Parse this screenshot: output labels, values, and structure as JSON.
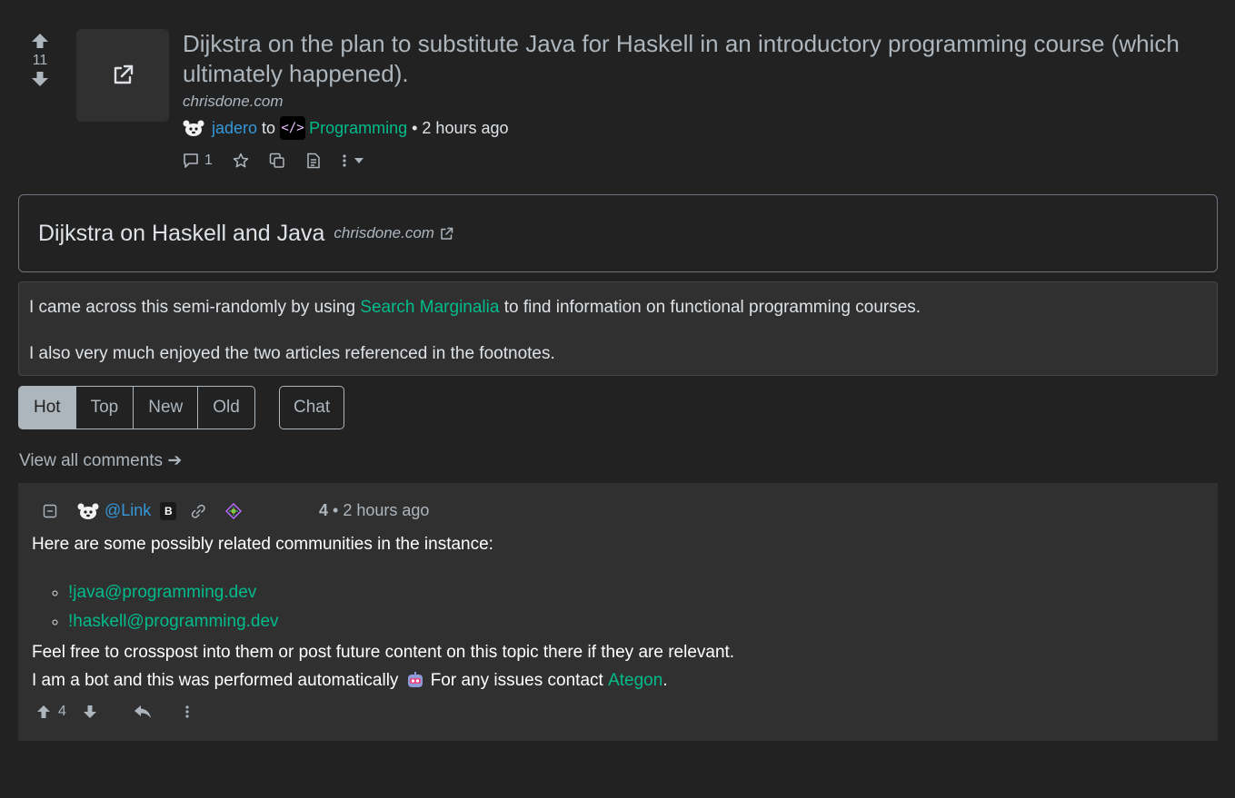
{
  "post": {
    "score": "11",
    "title": "Dijkstra on the plan to substitute Java for Haskell in an introductory programming course (which ultimately happened).",
    "domain": "chrisdone.com",
    "author": "jadero",
    "to": "to",
    "community_icon": "</>",
    "community": "Programming",
    "separator": "•",
    "time": "2 hours ago",
    "comment_count": "1"
  },
  "link_card": {
    "title": "Dijkstra on Haskell and Java",
    "domain": "chrisdone.com"
  },
  "body": {
    "p1_before": "I came across this semi-randomly by using ",
    "p1_link": "Search Marginalia",
    "p1_after": " to find information on functional programming courses.",
    "p2": "I also very much enjoyed the two articles referenced in the footnotes."
  },
  "sort": {
    "buttons": [
      "Hot",
      "Top",
      "New",
      "Old"
    ],
    "active": "Hot",
    "chat": "Chat"
  },
  "view_all": "View all comments ➔",
  "comment": {
    "user": "@Link",
    "badge": "B",
    "score": "4",
    "separator": "•",
    "time": "2 hours ago",
    "intro": "Here are some possibly related communities in the instance:",
    "communities": [
      "!java@programming.dev",
      "!haskell@programming.dev"
    ],
    "line2": "Feel free to crosspost into them or post future content on this topic there if they are relevant.",
    "line3_before": "I am a bot and this was performed automatically",
    "line3_mid": " For any issues contact ",
    "line3_link": "Ategon",
    "line3_end": ".",
    "upvotes": "4"
  },
  "colors": {
    "background": "#222222",
    "card": "#303030",
    "link": "#00bc8c",
    "user": "#3498db",
    "muted": "#adb5bd"
  }
}
